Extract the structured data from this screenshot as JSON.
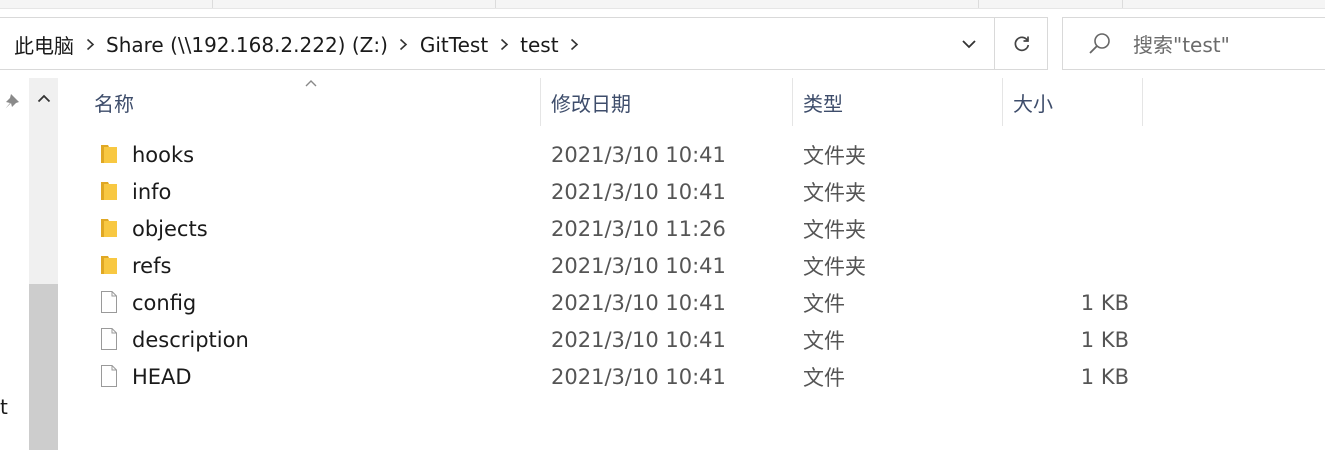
{
  "address_bar": {
    "breadcrumbs": [
      "此电脑",
      "Share (\\\\192.168.2.222) (Z:)",
      "GitTest",
      "test"
    ]
  },
  "search": {
    "placeholder": "搜索\"test\""
  },
  "nav_pane": {
    "partial_label": "t"
  },
  "columns": {
    "name": "名称",
    "date": "修改日期",
    "type": "类型",
    "size": "大小"
  },
  "files": [
    {
      "name": "hooks",
      "date": "2021/3/10 10:41",
      "type": "文件夹",
      "size": "",
      "icon": "folder-icon"
    },
    {
      "name": "info",
      "date": "2021/3/10 10:41",
      "type": "文件夹",
      "size": "",
      "icon": "folder-icon"
    },
    {
      "name": "objects",
      "date": "2021/3/10 11:26",
      "type": "文件夹",
      "size": "",
      "icon": "folder-icon"
    },
    {
      "name": "refs",
      "date": "2021/3/10 10:41",
      "type": "文件夹",
      "size": "",
      "icon": "folder-icon"
    },
    {
      "name": "config",
      "date": "2021/3/10 10:41",
      "type": "文件",
      "size": "1 KB",
      "icon": "file-icon"
    },
    {
      "name": "description",
      "date": "2021/3/10 10:41",
      "type": "文件",
      "size": "1 KB",
      "icon": "file-icon"
    },
    {
      "name": "HEAD",
      "date": "2021/3/10 10:41",
      "type": "文件",
      "size": "1 KB",
      "icon": "file-icon"
    }
  ],
  "colors": {
    "folder": "#f8c842",
    "folder_dark": "#e0a824",
    "header_text": "#3e4d6b",
    "border": "#d9d9d9"
  }
}
